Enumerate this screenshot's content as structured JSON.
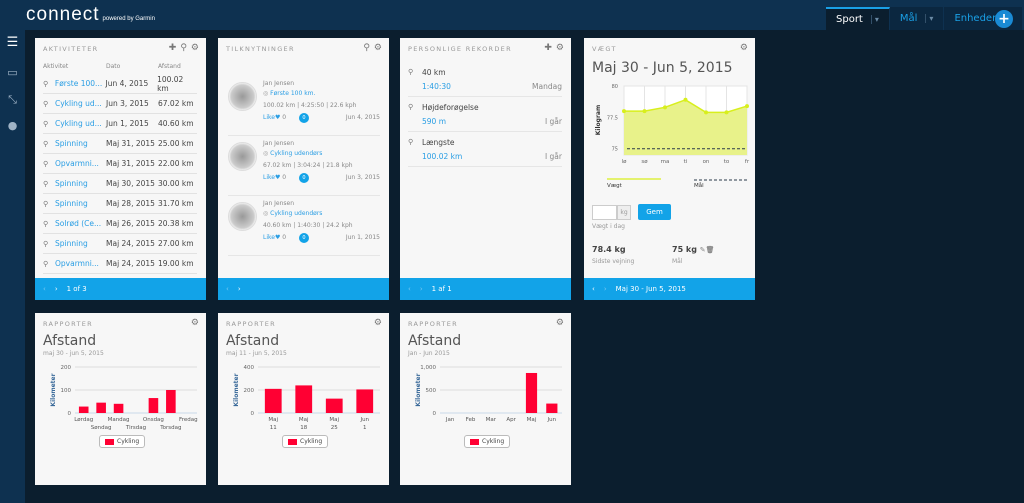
{
  "header": {
    "logo": "connect",
    "logo_sub": "powered by Garmin",
    "tabs": [
      {
        "label": "Sport",
        "active": true
      },
      {
        "label": "Mål"
      },
      {
        "label": "Enheder"
      }
    ],
    "add_icon": "plus-circle-icon"
  },
  "sidebar": {
    "icons": [
      "menu-icon",
      "inbox-icon",
      "connections-icon",
      "user-icon"
    ]
  },
  "colors": {
    "accent": "#12a3e8",
    "header": "#0e3150",
    "background": "#0b1e2e",
    "bar": "#ff0033",
    "weight_line": "#d8ef1c"
  },
  "activities": {
    "title": "AKTIVITETER",
    "headers": [
      "Aktivitet",
      "Dato",
      "Afstand"
    ],
    "rows": [
      {
        "name": "Første 100...",
        "date": "Jun 4, 2015",
        "dist": "100.02 km"
      },
      {
        "name": "Cykling ud...",
        "date": "Jun 3, 2015",
        "dist": "67.02 km"
      },
      {
        "name": "Cykling ud...",
        "date": "Jun 1, 2015",
        "dist": "40.60 km"
      },
      {
        "name": "Spinning",
        "date": "Maj 31, 2015",
        "dist": "25.00 km"
      },
      {
        "name": "Opvarmni...",
        "date": "Maj 31, 2015",
        "dist": "22.00 km"
      },
      {
        "name": "Spinning",
        "date": "Maj 30, 2015",
        "dist": "30.00 km"
      },
      {
        "name": "Spinning",
        "date": "Maj 28, 2015",
        "dist": "31.70 km"
      },
      {
        "name": "Solrød (Ce...",
        "date": "Maj 26, 2015",
        "dist": "20.38 km"
      },
      {
        "name": "Spinning",
        "date": "Maj 24, 2015",
        "dist": "27.00 km"
      },
      {
        "name": "Opvarmni...",
        "date": "Maj 24, 2015",
        "dist": "19.00 km"
      }
    ],
    "pager": "1 of 3"
  },
  "connections": {
    "title": "TILKNYTNINGER",
    "items": [
      {
        "user": "Jan Jensen",
        "activity": "Første 100 km.",
        "stats": "100.02 km | 4:25:50 | 22.6 kph",
        "like": "Like",
        "likes": "0",
        "comments": "0",
        "date": "Jun 4, 2015"
      },
      {
        "user": "Jan Jensen",
        "activity": "Cykling udendørs",
        "stats": "67.02 km | 3:04:24 | 21.8 kph",
        "like": "Like",
        "likes": "0",
        "comments": "0",
        "date": "Jun 3, 2015"
      },
      {
        "user": "Jan Jensen",
        "activity": "Cykling udendørs",
        "stats": "40.60 km | 1:40:30 | 24.2 kph",
        "like": "Like",
        "likes": "0",
        "comments": "0",
        "date": "Jun 1, 2015"
      }
    ]
  },
  "records": {
    "title": "PERSONLIGE REKORDER",
    "items": [
      {
        "name": "40 km",
        "value": "1:40:30",
        "when": "Mandag"
      },
      {
        "name": "Højdeforøgelse",
        "value": "590 m",
        "when": "I går"
      },
      {
        "name": "Længste",
        "value": "100.02 km",
        "when": "I går"
      }
    ],
    "pager": "1 af 1"
  },
  "weight": {
    "title": "VÆGT",
    "heading": "Maj 30 - Jun 5, 2015",
    "input_unit": "kg",
    "save": "Gem",
    "input_label": "Vægt i dag",
    "last_value": "78.4 kg",
    "last_label": "Sidste vejning",
    "goal_value": "75 kg",
    "goal_label": "Mål",
    "footer": "Maj 30 - Jun 5, 2015"
  },
  "reports": [
    {
      "title": "RAPPORTER",
      "heading": "Afstand",
      "subtitle": "maj 30 - jun 5, 2015"
    },
    {
      "title": "RAPPORTER",
      "heading": "Afstand",
      "subtitle": "maj 11 - jun 5, 2015"
    },
    {
      "title": "RAPPORTER",
      "heading": "Afstand",
      "subtitle": "Jan - Jun 2015"
    }
  ],
  "chart_data": [
    {
      "type": "area",
      "ylabel": "Kilogram",
      "categories": [
        "lø",
        "sø",
        "ma",
        "ti",
        "on",
        "to",
        "fr"
      ],
      "ylim": [
        74.5,
        80
      ],
      "yticks": [
        "75",
        "77.5",
        "80"
      ],
      "series": [
        {
          "name": "Vægt",
          "values": [
            78.0,
            78.0,
            78.3,
            78.9,
            77.9,
            77.9,
            78.4
          ]
        },
        {
          "name": "Mål",
          "values": [
            75,
            75,
            75,
            75,
            75,
            75,
            75
          ]
        }
      ],
      "grid": true,
      "legend": "bottom"
    },
    {
      "type": "bar",
      "ylabel": "Kilometer",
      "categories": [
        "Lørdag",
        "Søndag",
        "Mandag",
        "Tirsdag",
        "Onsdag",
        "Torsdag",
        "Fredag"
      ],
      "ylim": [
        0,
        200
      ],
      "yticks": [
        "0",
        "100",
        "200"
      ],
      "series": [
        {
          "name": "Cykling",
          "values": [
            28,
            45,
            40,
            0,
            65,
            100,
            0
          ]
        }
      ],
      "legend": "bottom"
    },
    {
      "type": "bar",
      "ylabel": "Kilometer",
      "categories": [
        "Maj 11",
        "Maj 18",
        "Maj 25",
        "Jun 1"
      ],
      "ylim": [
        0,
        400
      ],
      "yticks": [
        "0",
        "200",
        "400"
      ],
      "series": [
        {
          "name": "Cykling",
          "values": [
            210,
            240,
            125,
            205
          ]
        }
      ],
      "legend": "bottom"
    },
    {
      "type": "bar",
      "ylabel": "Kilometer",
      "categories": [
        "Jan",
        "Feb",
        "Mar",
        "Apr",
        "Maj",
        "Jun"
      ],
      "ylim": [
        0,
        1000
      ],
      "yticks": [
        "0",
        "500",
        "1,000"
      ],
      "series": [
        {
          "name": "Cykling",
          "values": [
            0,
            0,
            0,
            0,
            870,
            205
          ]
        }
      ],
      "legend": "bottom"
    }
  ]
}
